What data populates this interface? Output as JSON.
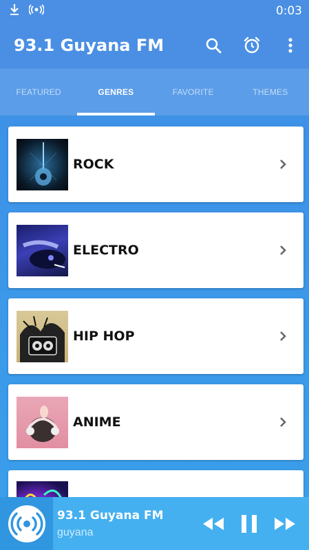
{
  "status_bar": {
    "time": "0:03",
    "icons": [
      "download-icon",
      "radio-signal-icon"
    ]
  },
  "app_bar": {
    "title": "93.1 Guyana FM",
    "actions": [
      "search-icon",
      "alarm-clock-icon",
      "more-vert-icon"
    ]
  },
  "tabs": [
    {
      "label": "FEATURED",
      "active": false
    },
    {
      "label": "GENRES",
      "active": true
    },
    {
      "label": "FAVORITE",
      "active": false
    },
    {
      "label": "THEMES",
      "active": false
    }
  ],
  "genres": [
    {
      "label": "ROCK",
      "thumb": "guitar-image"
    },
    {
      "label": "ELECTRO",
      "thumb": "dj-turntable-image"
    },
    {
      "label": "HIP HOP",
      "thumb": "graffiti-boombox-image"
    },
    {
      "label": "ANIME",
      "thumb": "anime-headphones-image"
    },
    {
      "label": "",
      "thumb": "colorful-music-image"
    }
  ],
  "player": {
    "station": "93.1 Guyana FM",
    "subtitle": "guyana",
    "controls": [
      "rewind-icon",
      "pause-icon",
      "fast-forward-icon"
    ]
  },
  "colors": {
    "primary": "#4a8fe3",
    "tab_bar": "#5b9de8",
    "player": "#44b0f0",
    "card": "#ffffff"
  }
}
